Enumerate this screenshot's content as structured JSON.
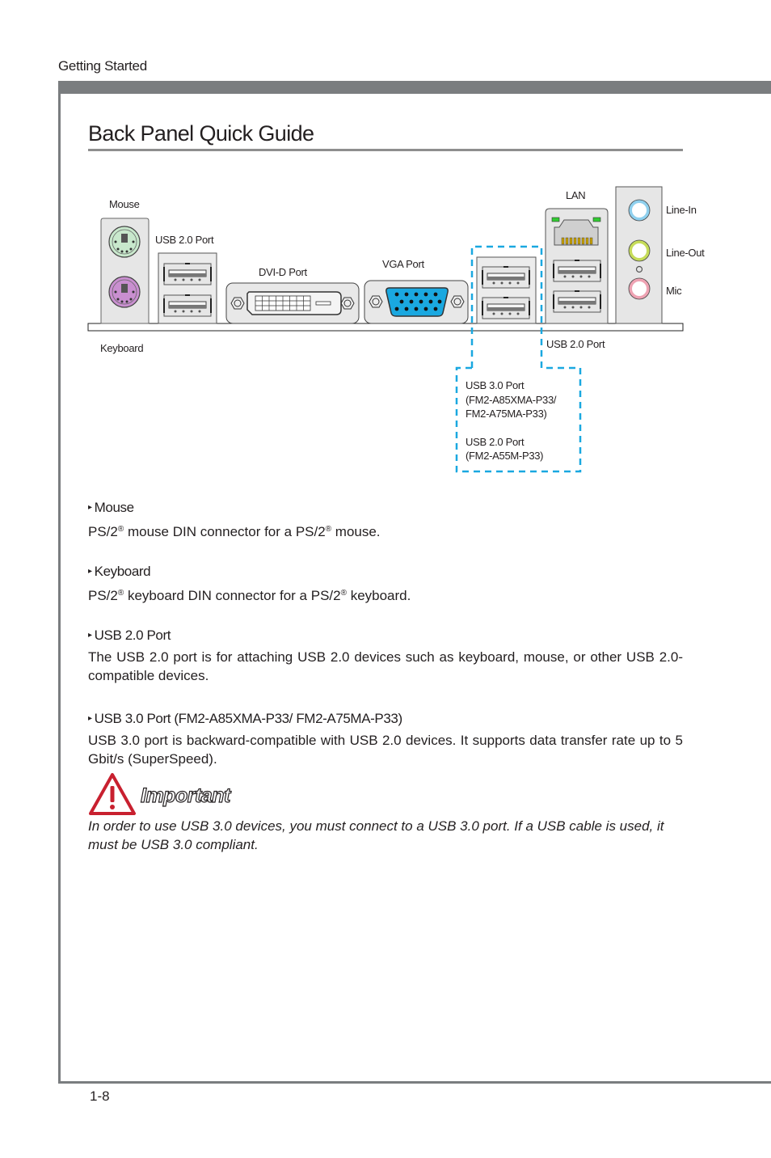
{
  "header": {
    "section": "Getting Started"
  },
  "page": {
    "title": "Back Panel Quick Guide",
    "number": "1-8"
  },
  "diagram": {
    "labels": {
      "mouse": "Mouse",
      "keyboard": "Keyboard",
      "usb2_left": "USB 2.0 Port",
      "dvi": "DVI-D Port",
      "vga": "VGA Port",
      "lan": "LAN",
      "usb2_right": "USB 2.0 Port",
      "line_in": "Line-In",
      "line_out": "Line-Out",
      "mic": "Mic",
      "callout_line1": "USB 3.0 Port",
      "callout_line2": "(FM2-A85XMA-P33/",
      "callout_line3": "FM2-A75MA-P33)",
      "callout_line4": "USB 2.0 Port",
      "callout_line5": "(FM2-A55M-P33)"
    },
    "colors": {
      "mouse_port": "#c8e8cc",
      "keyboard_port": "#c98fd0",
      "vga_port": "#1aa8e0",
      "lan_led": "#33cc33",
      "line_in": "#8fd0ee",
      "line_out": "#c6dc5a",
      "mic": "#eea3b3",
      "callout_dash": "#1aa8e0"
    }
  },
  "descriptions": [
    {
      "heading": "Mouse",
      "body_pre": "PS/2",
      "body_mid": " mouse DIN connector for a PS/2",
      "body_post": " mouse.",
      "reg": "®"
    },
    {
      "heading": "Keyboard",
      "body_pre": "PS/2",
      "body_mid": " keyboard DIN connector for a PS/2",
      "body_post": " keyboard.",
      "reg": "®"
    },
    {
      "heading": "USB 2.0 Port",
      "body": "The USB 2.0 port is for attaching USB 2.0 devices such as keyboard, mouse, or other USB 2.0-compatible devices."
    },
    {
      "heading": "USB 3.0 Port (FM2-A85XMA-P33/ FM2-A75MA-P33)",
      "body": "USB 3.0 port is backward-compatible with USB 2.0 devices. It supports data transfer rate up to 5 Gbit/s (SuperSpeed)."
    }
  ],
  "important": {
    "title": "Important",
    "body": "In order to use USB 3.0 devices, you must connect to a USB 3.0 port. If a USB cable is used, it must be USB 3.0 compliant.",
    "icon": "warning-triangle-icon",
    "icon_color": "#c8202f"
  },
  "bullet_glyph": "▸"
}
